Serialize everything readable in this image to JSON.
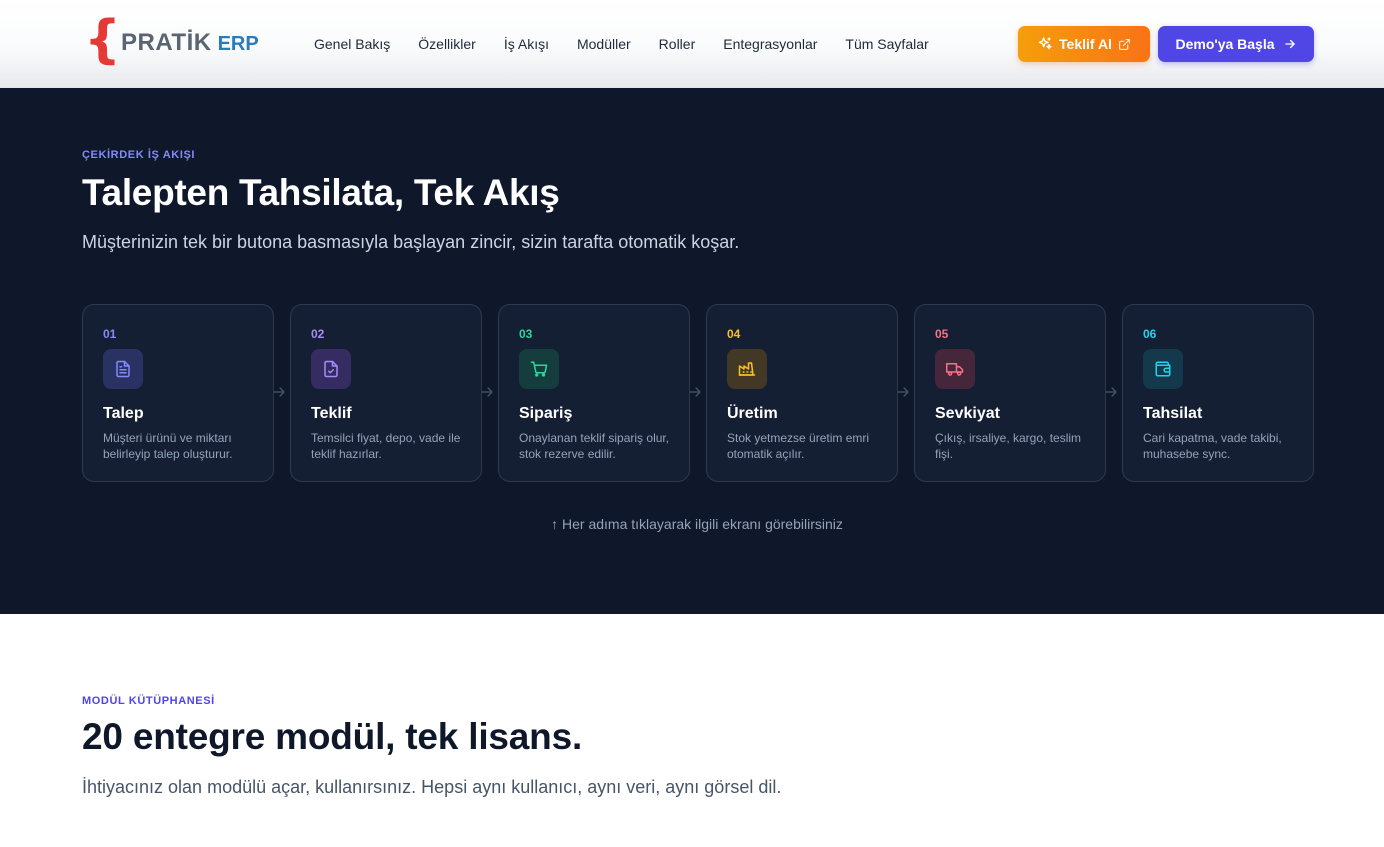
{
  "brand": {
    "name": "PRATİK",
    "suffix": "ERP",
    "brace": "{"
  },
  "nav": {
    "items": [
      {
        "label": "Genel Bakış"
      },
      {
        "label": "Özellikler"
      },
      {
        "label": "İş Akışı"
      },
      {
        "label": "Modüller"
      },
      {
        "label": "Roller"
      },
      {
        "label": "Entegrasyonlar"
      },
      {
        "label": "Tüm Sayfalar"
      }
    ]
  },
  "actions": {
    "teklif_label": "Teklif Al",
    "teklif_icons": [
      "sparkles-icon",
      "external-link-icon"
    ],
    "demo_label": "Demo'ya Başla",
    "demo_icon": "arrow-right-icon"
  },
  "workflow": {
    "eyebrow": "ÇEKİRDEK İŞ AKIŞI",
    "title": "Talepten Tahsilata, Tek Akış",
    "subtitle": "Müşterinizin tek bir butona basmasıyla başlayan zincir, sizin tarafta otomatik koşar.",
    "steps": [
      {
        "num": "01",
        "title": "Talep",
        "desc": "Müşteri ürünü ve miktarı belirleyip talep oluşturur.",
        "icon": "file-text-icon",
        "color": "#818cf8",
        "bg": "#2a3163"
      },
      {
        "num": "02",
        "title": "Teklif",
        "desc": "Temsilci fiyat, depo, vade ile teklif hazırlar.",
        "icon": "file-check-icon",
        "color": "#a78bfa",
        "bg": "#352d62"
      },
      {
        "num": "03",
        "title": "Sipariş",
        "desc": "Onaylanan teklif sipariş olur, stok rezerve edilir.",
        "icon": "shopping-cart-icon",
        "color": "#34d399",
        "bg": "#163d3d"
      },
      {
        "num": "04",
        "title": "Üretim",
        "desc": "Stok yetmezse üretim emri otomatik açılır.",
        "icon": "factory-icon",
        "color": "#fbbf24",
        "bg": "#433825"
      },
      {
        "num": "05",
        "title": "Sevkiyat",
        "desc": "Çıkış, irsaliye, kargo, teslim fişi.",
        "icon": "truck-icon",
        "color": "#fb7185",
        "bg": "#45263a"
      },
      {
        "num": "06",
        "title": "Tahsilat",
        "desc": "Cari kapatma, vade takibi, muhasebe sync.",
        "icon": "wallet-icon",
        "color": "#22d3ee",
        "bg": "#14394d"
      }
    ],
    "hint": "↑ Her adıma tıklayarak ilgili ekranı görebilirsiniz"
  },
  "modules": {
    "eyebrow": "MODÜL KÜTÜPHANESİ",
    "title": "20 entegre modül, tek lisans.",
    "subtitle": "İhtiyacınız olan modülü açar, kullanırsınız. Hepsi aynı kullanıcı, aynı veri, aynı görsel dil."
  }
}
